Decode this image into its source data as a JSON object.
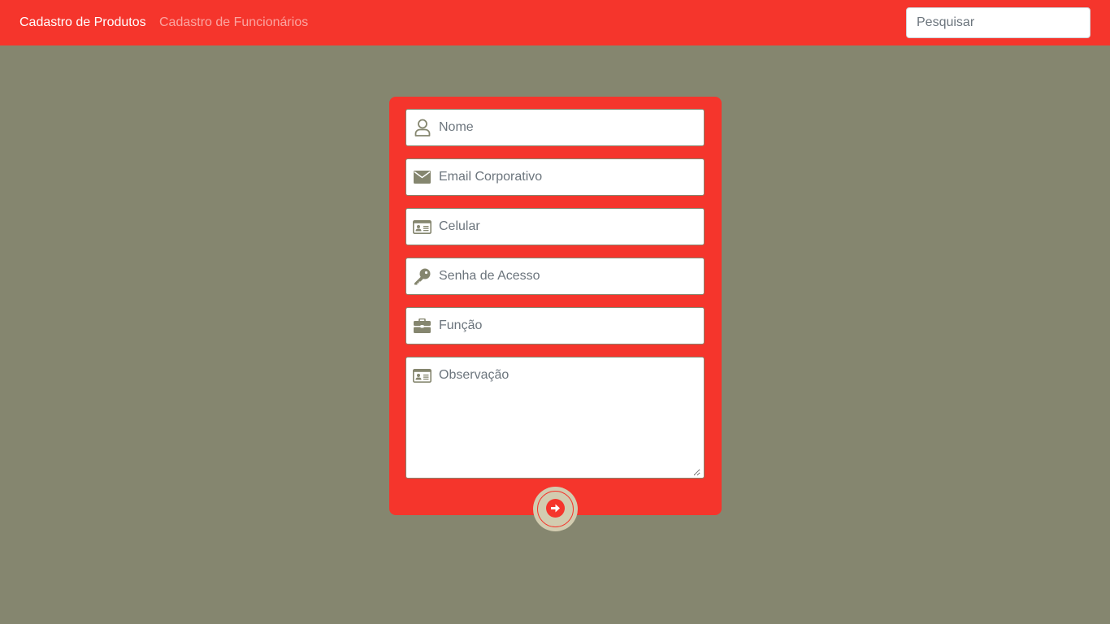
{
  "navbar": {
    "links": [
      {
        "label": "Cadastro de Produtos",
        "active": true
      },
      {
        "label": "Cadastro de Funcionários",
        "active": false
      }
    ],
    "search": {
      "placeholder": "Pesquisar",
      "value": ""
    }
  },
  "form": {
    "fields": [
      {
        "icon": "user-icon",
        "placeholder": "Nome",
        "value": ""
      },
      {
        "icon": "envelope-icon",
        "placeholder": "Email Corporativo",
        "value": ""
      },
      {
        "icon": "id-card-icon",
        "placeholder": "Celular",
        "value": ""
      },
      {
        "icon": "key-icon",
        "placeholder": "Senha de Acesso",
        "value": ""
      },
      {
        "icon": "briefcase-icon",
        "placeholder": "Função",
        "value": ""
      },
      {
        "icon": "id-card-icon",
        "placeholder": "Observação",
        "value": ""
      }
    ],
    "submit": {
      "icon": "arrow-circle-right-icon"
    }
  },
  "colors": {
    "accent": "#f5352c",
    "background": "#85866f",
    "icon": "#85866f",
    "submit_bg": "#d2ccb0"
  }
}
